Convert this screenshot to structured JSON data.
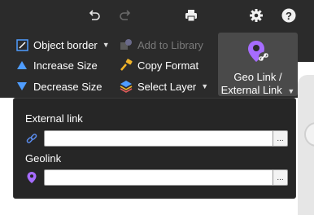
{
  "toolbar": {
    "undo_icon": "undo-icon",
    "redo_icon": "redo-icon",
    "print_icon": "print-icon",
    "settings_icon": "gear-icon",
    "help_icon": "help-icon",
    "help_glyph": "?"
  },
  "ribbon": {
    "object_border": "Object border",
    "add_to_library": "Add to Library",
    "increase_size": "Increase Size",
    "copy_format": "Copy Format",
    "decrease_size": "Decrease Size",
    "select_layer": "Select Layer",
    "geo_link_line1": "Geo Link /",
    "geo_link_line2": "External Link"
  },
  "dropdown": {
    "external_link_label": "External link",
    "external_link_value": "",
    "geolink_label": "Geolink",
    "geolink_value": "",
    "more_glyph": "..."
  },
  "colors": {
    "toolbar_bg": "#2b2b2b",
    "accent_purple": "#a66cff",
    "link_blue": "#5b8def"
  }
}
